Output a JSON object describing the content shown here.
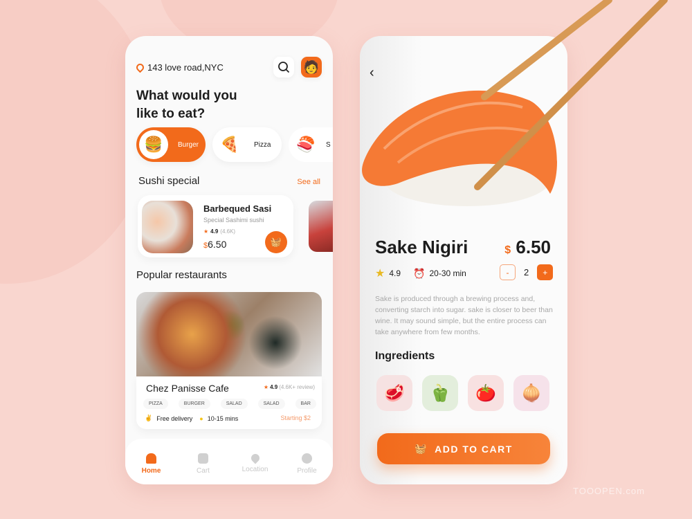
{
  "colors": {
    "accent": "#f26a1b",
    "background": "#f9d6cf"
  },
  "left": {
    "address": "143 love road,NYC",
    "title_line1": "What would you",
    "title_line2": "like to eat?",
    "categories": [
      {
        "label": "Burger",
        "icon": "burger-icon",
        "emoji": "🍔",
        "active": true
      },
      {
        "label": "Pizza",
        "icon": "pizza-icon",
        "emoji": "🍕",
        "active": false
      },
      {
        "label": "S",
        "icon": "sushi-icon",
        "emoji": "🍣",
        "active": false
      }
    ],
    "sushi_section": {
      "title": "Sushi special",
      "see_all": "See all",
      "card": {
        "name": "Barbequed Sasi",
        "subtitle": "Special Sashimi sushi",
        "rating": "4.9",
        "reviews": "(4.6K)",
        "currency": "$",
        "price": "6.50"
      }
    },
    "popular": {
      "title": "Popular restaurants",
      "restaurant": {
        "name": "Chez Panisse Cafe",
        "rating": "4.9",
        "reviews": "(4.6K+ review)",
        "tags": [
          "PIZZA",
          "BURGER",
          "SALAD",
          "SALAD",
          "BAR"
        ],
        "delivery": "Free delivery",
        "time": "10-15 mins",
        "starting": "Starting $2"
      }
    },
    "nav": [
      {
        "label": "Home",
        "active": true
      },
      {
        "label": "Cart"
      },
      {
        "label": "Location"
      },
      {
        "label": "Profile"
      }
    ]
  },
  "right": {
    "name": "Sake Nigiri",
    "currency": "$",
    "price": "6.50",
    "rating": "4.9",
    "time": "20-30 min",
    "quantity": "2",
    "minus": "-",
    "plus": "+",
    "description": "Sake is produced through a brewing process and, converting starch into sugar. sake is closer to beer than wine. It may sound simple, but the entire process can take anywhere from few months.",
    "ingredients_title": "Ingredients",
    "ingredients": [
      {
        "icon": "meat-icon",
        "emoji": "🥩",
        "bg": "#f6e2e2"
      },
      {
        "icon": "pepper-icon",
        "emoji": "🫑",
        "bg": "#e3eedc"
      },
      {
        "icon": "tomato-icon",
        "emoji": "🍅",
        "bg": "#f8e1e1"
      },
      {
        "icon": "onion-icon",
        "emoji": "🧅",
        "bg": "#f6e2ea"
      }
    ],
    "add_to_cart": "ADD TO CART"
  },
  "watermark": "TOOOPEN.com"
}
